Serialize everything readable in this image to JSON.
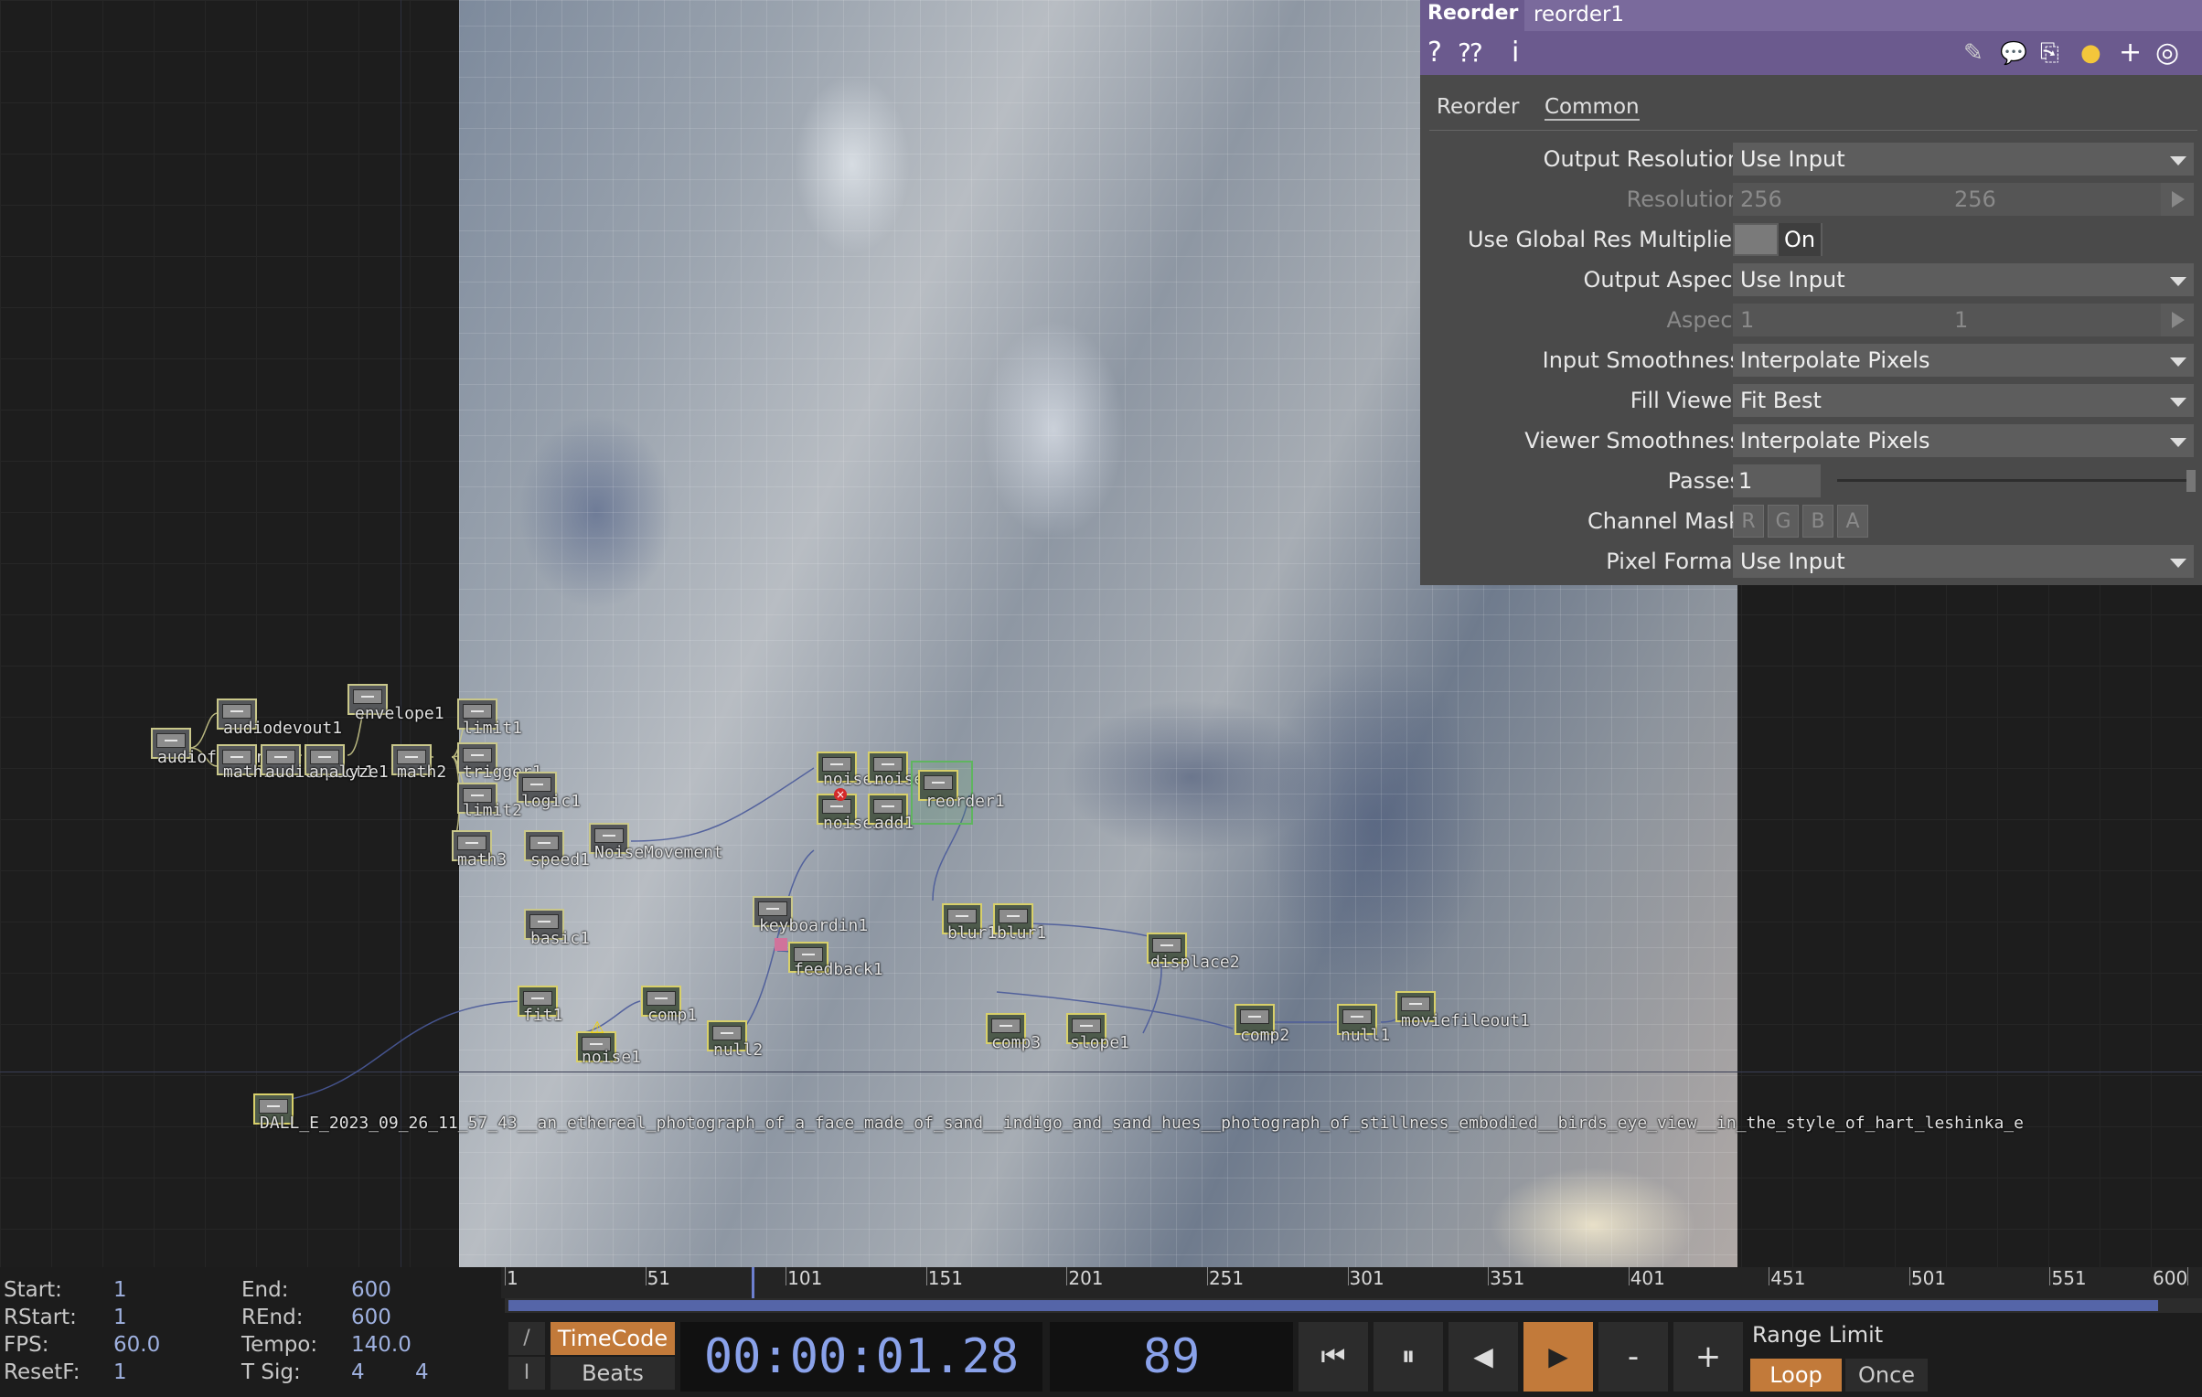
{
  "network": {
    "nodes": [
      {
        "id": "audiofilein1",
        "label": "audiofilein1"
      },
      {
        "id": "audiodevout1",
        "label": "audiodevout1"
      },
      {
        "id": "math1",
        "label": "math1"
      },
      {
        "id": "audiospect1",
        "label": "audiospect1"
      },
      {
        "id": "analyze1",
        "label": "analyze1"
      },
      {
        "id": "envelope1",
        "label": "envelope1"
      },
      {
        "id": "math2",
        "label": "math2"
      },
      {
        "id": "limit1",
        "label": "limit1"
      },
      {
        "id": "trigger1",
        "label": "trigger1"
      },
      {
        "id": "limit2",
        "label": "limit2"
      },
      {
        "id": "logic1",
        "label": "logic1"
      },
      {
        "id": "math3",
        "label": "math3"
      },
      {
        "id": "speed1",
        "label": "speed1"
      },
      {
        "id": "NoiseMovement",
        "label": "NoiseMovement"
      },
      {
        "id": "noise2",
        "label": "noise2"
      },
      {
        "id": "noise4",
        "label": "noise4"
      },
      {
        "id": "noise3",
        "label": "noise3"
      },
      {
        "id": "add1",
        "label": "add1"
      },
      {
        "id": "reorder1",
        "label": "reorder1"
      },
      {
        "id": "basic1",
        "label": "basic1"
      },
      {
        "id": "keyboardin1",
        "label": "keyboardin1"
      },
      {
        "id": "feedback1",
        "label": "feedback1"
      },
      {
        "id": "blur1",
        "label": "blur1"
      },
      {
        "id": "blur2",
        "label": "blur1"
      },
      {
        "id": "displace2",
        "label": "displace2"
      },
      {
        "id": "fit1",
        "label": "fit1"
      },
      {
        "id": "comp1",
        "label": "comp1"
      },
      {
        "id": "noise1",
        "label": "noise1"
      },
      {
        "id": "null2",
        "label": "null2"
      },
      {
        "id": "comp3",
        "label": "comp3"
      },
      {
        "id": "slope1",
        "label": "slope1"
      },
      {
        "id": "comp2",
        "label": "comp2"
      },
      {
        "id": "null1",
        "label": "null1"
      },
      {
        "id": "moviefileout1",
        "label": "moviefileout1"
      },
      {
        "id": "dalle",
        "label": "DALL_E_2023_09_26_11_57_43__an_ethereal_photograph_of_a_face_made_of_sand__indigo_and_sand_hues__photograph_of_stillness_embodied__birds_eye_view__in_the_style_of_hart_leshinka_e"
      }
    ]
  },
  "params": {
    "op_type": "Reorder",
    "op_name": "reorder1",
    "tabs": [
      "Reorder",
      "Common"
    ],
    "active_tab": "Common",
    "output_resolution": {
      "label": "Output Resolution",
      "value": "Use Input"
    },
    "resolution": {
      "label": "Resolution",
      "w": "256",
      "h": "256"
    },
    "global_res": {
      "label": "Use Global Res Multiplier",
      "value": "On"
    },
    "output_aspect": {
      "label": "Output Aspect",
      "value": "Use Input"
    },
    "aspect": {
      "label": "Aspect",
      "w": "1",
      "h": "1"
    },
    "input_smoothness": {
      "label": "Input Smoothness",
      "value": "Interpolate Pixels"
    },
    "fill_viewer": {
      "label": "Fill Viewer",
      "value": "Fit Best"
    },
    "viewer_smoothness": {
      "label": "Viewer Smoothness",
      "value": "Interpolate Pixels"
    },
    "passes": {
      "label": "Passes",
      "value": "1"
    },
    "channel_mask": {
      "label": "Channel Mask",
      "channels": [
        "R",
        "G",
        "B",
        "A"
      ]
    },
    "pixel_format": {
      "label": "Pixel Format",
      "value": "Use Input"
    },
    "icons": [
      "help-icon",
      "python-help-icon",
      "info-icon",
      "edit-icon",
      "comment-icon",
      "clipboard-icon",
      "python-icon",
      "plus-icon",
      "target-icon"
    ]
  },
  "timeline": {
    "start": {
      "label": "Start:",
      "value": "1"
    },
    "end": {
      "label": "End:",
      "value": "600"
    },
    "rstart": {
      "label": "RStart:",
      "value": "1"
    },
    "rend": {
      "label": "REnd:",
      "value": "600"
    },
    "fps": {
      "label": "FPS:",
      "value": "60.0"
    },
    "tempo": {
      "label": "Tempo:",
      "value": "140.0"
    },
    "resetf": {
      "label": "ResetF:",
      "value": "1"
    },
    "tsig": {
      "label": "T Sig:",
      "value1": "4",
      "value2": "4"
    },
    "ruler_labels": [
      "1",
      "51",
      "101",
      "151",
      "201",
      "251",
      "301",
      "351",
      "401",
      "451",
      "501",
      "551",
      "600"
    ],
    "timecode_label": "TimeCode",
    "beats_label": "Beats",
    "slash_label": "/",
    "i_label": "I",
    "timecode": "00:00:01.28",
    "frame": "89",
    "minus_label": "-",
    "plus_label": "+",
    "range_limit_label": "Range Limit",
    "loop_label": "Loop",
    "once_label": "Once",
    "current_frame": 89,
    "frame_range": [
      1,
      600
    ]
  },
  "colors": {
    "panel_title": "#6b5a8e",
    "node_border": "#c9c78a",
    "timecode_text": "#8aa2ea",
    "active_button": "#c27a3a",
    "scrub_bar": "#5565a8"
  }
}
